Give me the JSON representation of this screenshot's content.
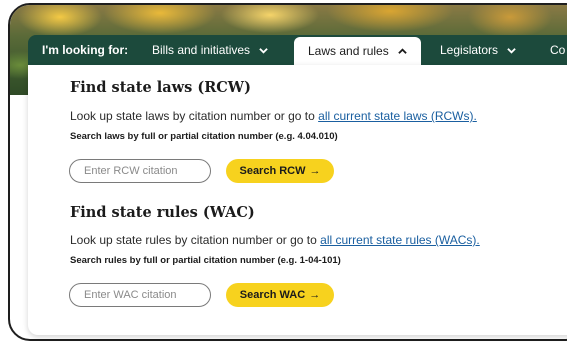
{
  "nav": {
    "label": "I'm looking for:",
    "items": [
      {
        "label": "Bills and initiatives",
        "active": false
      },
      {
        "label": "Laws and rules",
        "active": true
      },
      {
        "label": "Legislators",
        "active": false
      },
      {
        "label": "Co",
        "active": false
      }
    ]
  },
  "laws": {
    "title": "Find state laws (RCW)",
    "desc_prefix": "Look up state laws by citation number or go to ",
    "link": "all current state laws (RCWs).",
    "hint": "Search laws by full or partial citation number (e.g. 4.04.010)",
    "placeholder": "Enter RCW citation",
    "button": "Search RCW",
    "arrow": "→"
  },
  "rules": {
    "title": "Find state rules (WAC)",
    "desc_prefix": "Look up state rules by citation number or go to ",
    "link": "all current state rules (WACs).",
    "hint": "Search rules by full or partial citation number (e.g. 1-04-101)",
    "placeholder": "Enter WAC citation",
    "button": "Search WAC",
    "arrow": "→"
  },
  "colors": {
    "nav_bg": "#1c4a3c",
    "button_bg": "#f7d21e",
    "link": "#1a5fa0"
  }
}
